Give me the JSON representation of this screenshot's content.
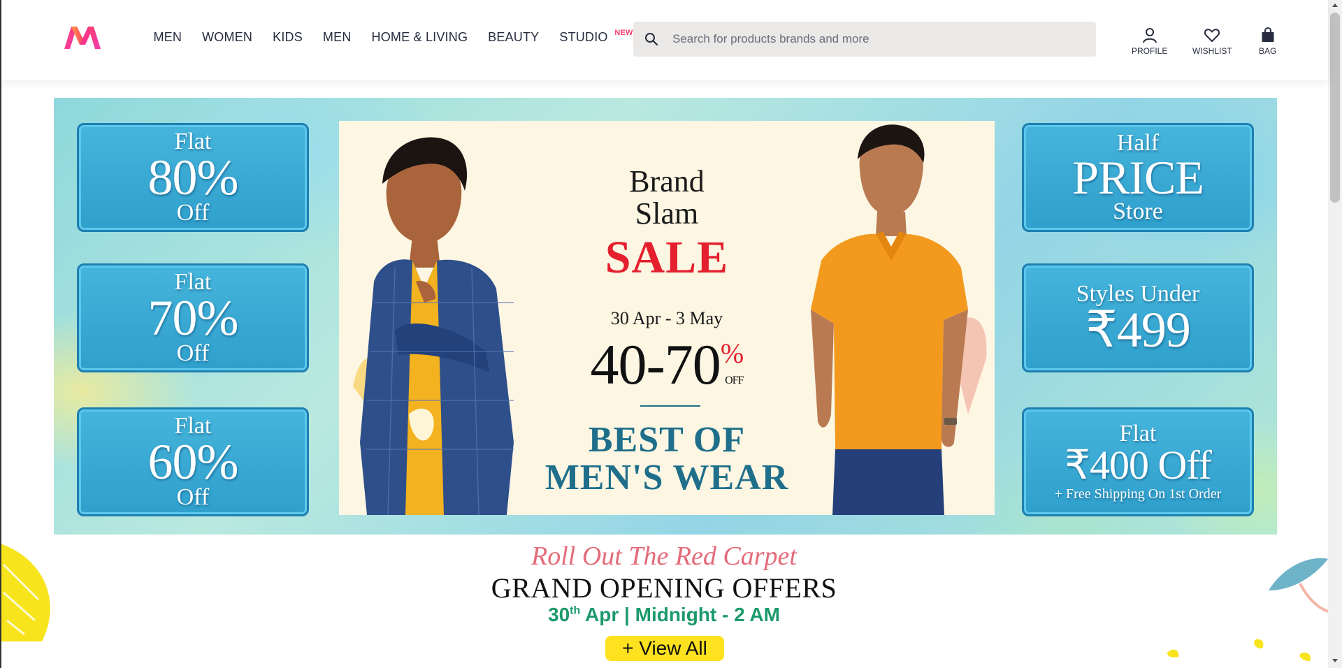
{
  "header": {
    "logo": "myntra-logo",
    "nav": [
      {
        "label": "MEN"
      },
      {
        "label": "WOMEN"
      },
      {
        "label": "KIDS"
      },
      {
        "label": "MEN"
      },
      {
        "label": "HOME & LIVING"
      },
      {
        "label": "BEAUTY"
      },
      {
        "label": "STUDIO",
        "badge": "NEW"
      }
    ],
    "search": {
      "placeholder": "Search for products brands and more",
      "value": "",
      "icon": "search-icon"
    },
    "actions": [
      {
        "label": "PROFILE",
        "icon": "profile-icon"
      },
      {
        "label": "WISHLIST",
        "icon": "heart-icon"
      },
      {
        "label": "BAG",
        "icon": "bag-icon"
      }
    ]
  },
  "banner": {
    "left_offers": [
      {
        "top": "Flat",
        "big": "80%",
        "bottom": "Off"
      },
      {
        "top": "Flat",
        "big": "70%",
        "bottom": "Off"
      },
      {
        "top": "Flat",
        "big": "60%",
        "bottom": "Off"
      }
    ],
    "right_offers": {
      "half": {
        "top": "Half",
        "big": "PRICE",
        "bottom": "Store"
      },
      "styles": {
        "top": "Styles Under",
        "big": "₹499"
      },
      "flat": {
        "top": "Flat",
        "big": "₹400 Off",
        "sub": "+ Free Shipping On 1st Order"
      }
    },
    "promo": {
      "brand_line1": "Brand",
      "brand_line2": "Slam",
      "sale": "SALE",
      "dates": "30 Apr - 3 May",
      "discount": "40-70",
      "discount_pct": "%",
      "discount_off": "OFF",
      "best_line1": "BEST OF",
      "best_line2": "MEN'S WEAR"
    }
  },
  "event": {
    "script": "Roll Out The Red Carpet",
    "title": "GRAND OPENING OFFERS",
    "time_day": "30",
    "time_sup": "th",
    "time_rest": " Apr | Midnight - 2 AM",
    "button": "+ View All"
  },
  "colors": {
    "brand_pink": "#ff3f6c",
    "search_bg": "#ebe8e8",
    "sale_red": "#e4202e",
    "teal_text": "#1f6f8b",
    "event_green": "#1c9a6c",
    "button_yellow": "#ffe21f"
  }
}
